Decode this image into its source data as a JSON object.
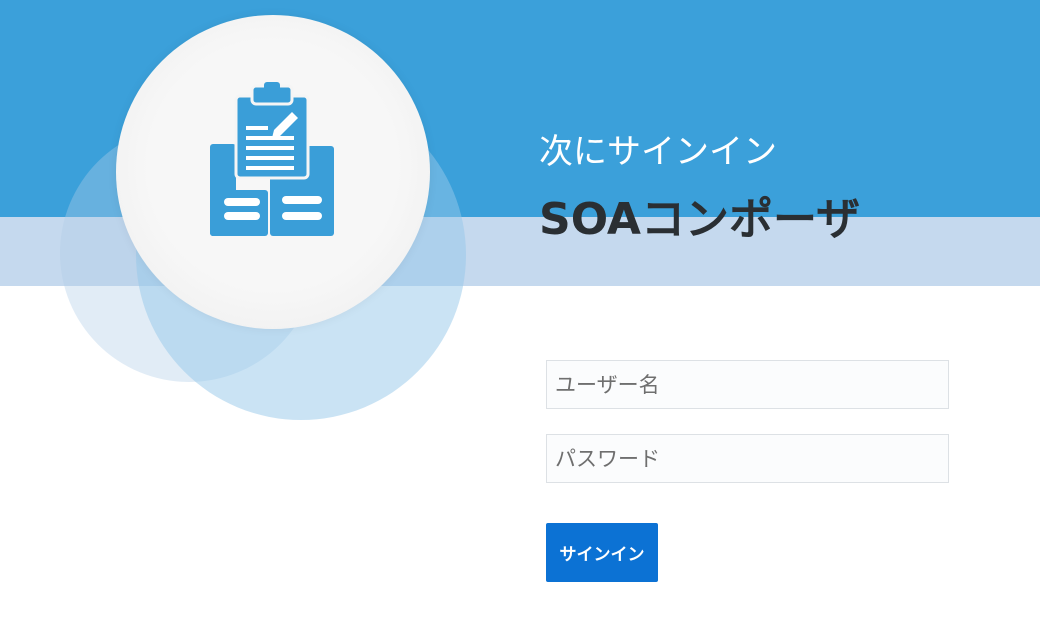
{
  "header": {
    "subtitle": "次にサインイン",
    "app_title": "SOAコンポーザ"
  },
  "logo": {
    "icon": "clipboard-documents-icon"
  },
  "form": {
    "username_placeholder": "ユーザー名",
    "username_value": "",
    "password_placeholder": "パスワード",
    "password_value": "",
    "signin_label": "サインイン"
  },
  "colors": {
    "header_blue": "#3ba0da",
    "header_light_band": "#c5d9ee",
    "button_blue": "#0c72d4",
    "title_text": "#2a2f33"
  }
}
